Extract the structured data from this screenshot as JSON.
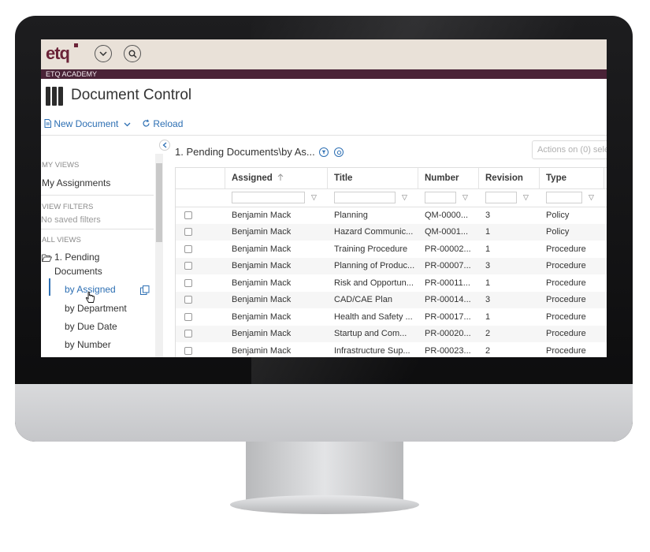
{
  "brand": {
    "logo": "etq",
    "academy": "ETQ ACADEMY"
  },
  "header": {
    "title": "Document Control"
  },
  "toolbar": {
    "new_document": "New Document",
    "reload": "Reload"
  },
  "sidebar": {
    "my_views_label": "MY VIEWS",
    "my_assignments": "My Assignments",
    "view_filters_label": "VIEW FILTERS",
    "no_saved_filters": "No saved filters",
    "all_views_label": "ALL VIEWS",
    "pending_line1": "1. Pending",
    "pending_line2": "Documents",
    "sub_items": [
      "by Assigned",
      "by Department",
      "by Due Date",
      "by Number"
    ]
  },
  "grid": {
    "view_title": "1. Pending Documents\\by As...",
    "actions_button": "Actions on (0) sele",
    "columns": [
      "Assigned",
      "Title",
      "Number",
      "Revision",
      "Type"
    ],
    "rows": [
      [
        "Benjamin Mack",
        "Planning",
        "QM-0000...",
        "3",
        "Policy"
      ],
      [
        "Benjamin Mack",
        "Hazard Communic...",
        "QM-0001...",
        "1",
        "Policy"
      ],
      [
        "Benjamin Mack",
        "Training Procedure",
        "PR-00002...",
        "1",
        "Procedure"
      ],
      [
        "Benjamin Mack",
        "Planning of Produc...",
        "PR-00007...",
        "3",
        "Procedure"
      ],
      [
        "Benjamin Mack",
        "Risk and Opportun...",
        "PR-00011...",
        "1",
        "Procedure"
      ],
      [
        "Benjamin Mack",
        "CAD/CAE Plan",
        "PR-00014...",
        "3",
        "Procedure"
      ],
      [
        "Benjamin Mack",
        "Health and Safety ...",
        "PR-00017...",
        "1",
        "Procedure"
      ],
      [
        "Benjamin Mack",
        "Startup and Com...",
        "PR-00020...",
        "2",
        "Procedure"
      ],
      [
        "Benjamin Mack",
        "Infrastructure Sup...",
        "PR-00023...",
        "2",
        "Procedure"
      ]
    ]
  },
  "icons": [
    "chevron-down-icon",
    "search-icon",
    "binders-icon",
    "document-icon",
    "reload-icon",
    "folder-open-icon",
    "copy-icon",
    "filter-icon",
    "sort-up-icon",
    "cursor-hand-icon"
  ],
  "colors": {
    "brand": "#6b2338",
    "academy_bar": "#4a2337",
    "topbar": "#e9e1d8",
    "link": "#2d6fb3"
  }
}
